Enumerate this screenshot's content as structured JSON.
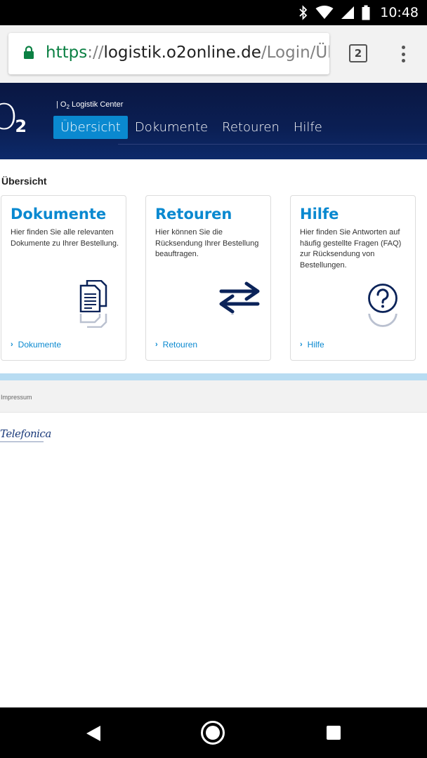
{
  "status_bar": {
    "time": "10:48",
    "icons": [
      "bluetooth-icon",
      "wifi-icon",
      "signal-icon",
      "battery-icon"
    ]
  },
  "browser": {
    "url_scheme": "https",
    "url_sep": "://",
    "url_host": "logistik.o2online.de",
    "url_path": "/Login/Übe",
    "tab_count": "2"
  },
  "header": {
    "logo_main": "O",
    "logo_sub": "2",
    "center_label_prefix": "| O",
    "center_label_sub": "2",
    "center_label_rest": " Logistik Center",
    "nav": [
      {
        "label": "Übersicht",
        "active": true
      },
      {
        "label": "Dokumente",
        "active": false
      },
      {
        "label": "Retouren",
        "active": false
      },
      {
        "label": "Hilfe",
        "active": false
      }
    ]
  },
  "main": {
    "section_title": "Übersicht",
    "cards": [
      {
        "title": "Dokumente",
        "text": "Hier finden Sie alle relevanten Dokumente zu Ihrer Bestellung.",
        "icon": "documents-icon",
        "link": "Dokumente"
      },
      {
        "title": "Retouren",
        "text": "Hier können Sie die Rücksendung Ihrer Bestellung beauftragen.",
        "icon": "exchange-arrows-icon",
        "link": "Retouren"
      },
      {
        "title": "Hilfe",
        "text": "Hier finden Sie Antworten auf häufig gestellte Fragen (FAQ) zur Rücksendung von Bestellungen.",
        "icon": "question-icon",
        "link": "Hilfe"
      }
    ]
  },
  "footer": {
    "impressum": "Impressum",
    "brand": "Telefonica"
  },
  "colors": {
    "accent": "#0a89d0",
    "header_bg": "#0b1f54",
    "icon_dark": "#0b2359"
  }
}
